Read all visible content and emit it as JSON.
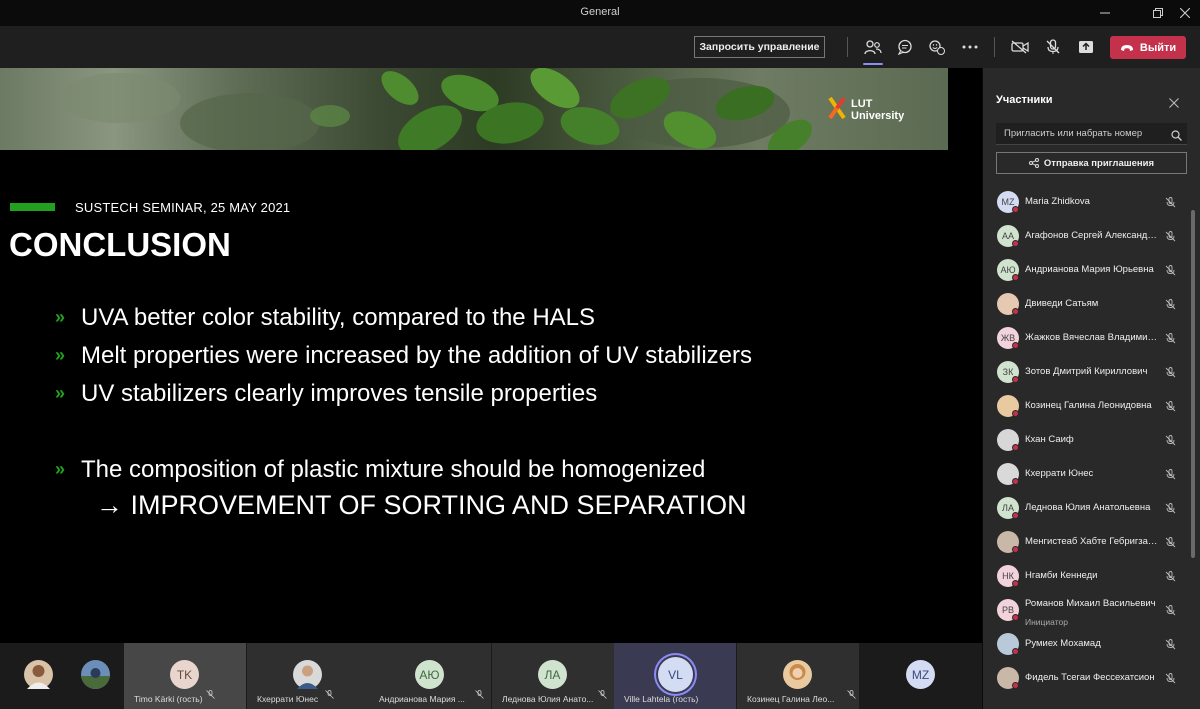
{
  "window": {
    "title": "General"
  },
  "toolbar": {
    "request_control": "Запросить управление",
    "leave": "Выйти",
    "icons": [
      "participants-icon",
      "chat-icon",
      "reactions-icon",
      "more-icon",
      "camera-off-icon",
      "mic-off-icon",
      "share-icon",
      "phone-icon"
    ]
  },
  "slide": {
    "logo_line1": "LUT",
    "logo_line2": "University",
    "seminar": "SUSTECH SEMINAR, 25 MAY 2021",
    "title": "CONCLUSION",
    "bullets": [
      "UVA better color stability, compared to the HALS",
      "Melt properties were increased by the addition of UV stabilizers",
      "UV stabilizers clearly improves tensile properties",
      "The composition of plastic mixture should be homogenized"
    ],
    "sub_bullet": "→ IMPROVEMENT OF SORTING AND SEPARATION",
    "accent_color": "#21a11f"
  },
  "gallery": [
    {
      "initials": "",
      "name": ""
    },
    {
      "initials": "",
      "name": ""
    },
    {
      "initials": "TK",
      "name": "Timo Kärki (гость)"
    },
    {
      "initials": "",
      "name": "Кхеррати Юнес"
    },
    {
      "initials": "АЮ",
      "name": "Андрианова Мария ..."
    },
    {
      "initials": "ЛА",
      "name": "Леднова Юлия Анато..."
    },
    {
      "initials": "VL",
      "name": "Ville Lahtela (гость)"
    },
    {
      "initials": "",
      "name": "Козинец Галина Лео..."
    },
    {
      "initials": "MZ",
      "name": ""
    }
  ],
  "panel": {
    "title": "Участники",
    "invite_placeholder": "Пригласить или набрать номер",
    "send_invite": "Отправка приглашения",
    "participants": [
      {
        "initials": "MZ",
        "name": "Maria Zhidkova",
        "role": ""
      },
      {
        "initials": "АА",
        "name": "Агафонов Сергей Александрович",
        "role": ""
      },
      {
        "initials": "АЮ",
        "name": "Андрианова Мария Юрьевна",
        "role": ""
      },
      {
        "initials": "",
        "name": "Двиведи Сатьям",
        "role": ""
      },
      {
        "initials": "ЖВ",
        "name": "Жажков Вячеслав Владимирович",
        "role": ""
      },
      {
        "initials": "ЗК",
        "name": "Зотов Дмитрий Кириллович",
        "role": ""
      },
      {
        "initials": "",
        "name": "Козинец Галина Леонидовна",
        "role": ""
      },
      {
        "initials": "",
        "name": "Кхан Саиф",
        "role": ""
      },
      {
        "initials": "",
        "name": "Кхеррати Юнес",
        "role": ""
      },
      {
        "initials": "ЛА",
        "name": "Леднова Юлия Анатольевна",
        "role": ""
      },
      {
        "initials": "",
        "name": "Менгистеаб Хабте Гебригзабер",
        "role": ""
      },
      {
        "initials": "НК",
        "name": "Нгамби Кеннеди",
        "role": ""
      },
      {
        "initials": "РВ",
        "name": "Романов Михаил Васильевич",
        "role": "Инициатор"
      },
      {
        "initials": "",
        "name": "Румиех Мохамад",
        "role": ""
      },
      {
        "initials": "",
        "name": "Фидель Тсегаи Фессехатсион",
        "role": ""
      }
    ]
  }
}
